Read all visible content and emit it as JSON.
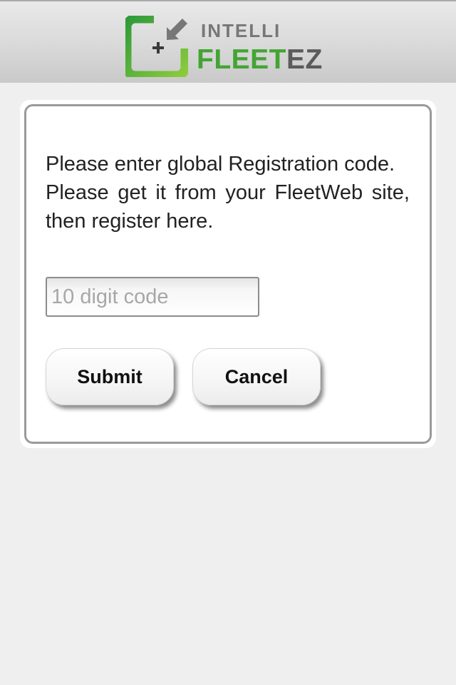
{
  "header": {
    "logo": {
      "icon": "plus-arrow-icon",
      "top_text": "INTELLI",
      "main_text_part1": "FLEET",
      "main_text_part2": "EZ",
      "colors": {
        "green": "#43a434",
        "gray": "#5b5b5b"
      }
    }
  },
  "registration": {
    "line1": "Please enter global Registration code.",
    "line2": "Please get it from your FleetWeb site, then register here.",
    "input": {
      "value": "",
      "placeholder": "10 digit code"
    },
    "submit_label": "Submit",
    "cancel_label": "Cancel"
  }
}
